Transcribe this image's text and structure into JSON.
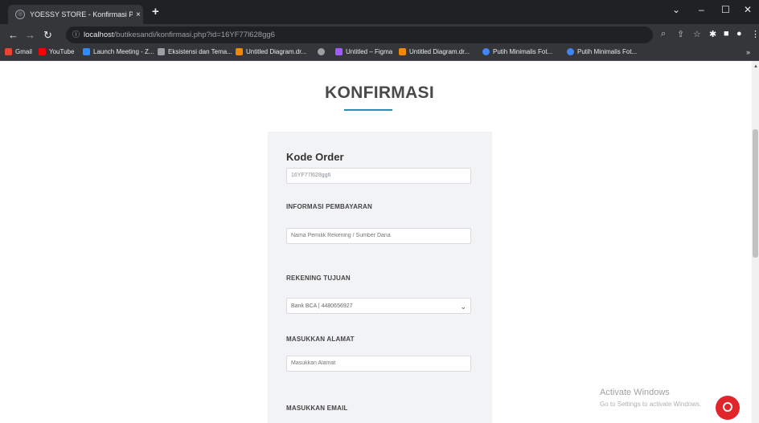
{
  "browser": {
    "tab_title": "YOESSY STORE - Konfirmasi Pem",
    "tab_close": "×",
    "new_tab": "+",
    "window_controls": [
      "⌄",
      "–",
      "☐",
      "✕"
    ],
    "url_host": "localhost",
    "url_path": "/butikesandi/konfirmasi.php?id=16YF77l628gg6",
    "bookmarks": [
      {
        "label": "Gmail",
        "color": "#ea4335"
      },
      {
        "label": "YouTube",
        "color": "#ff0000"
      },
      {
        "label": "Launch Meeting - Z...",
        "color": "#2d8cff"
      },
      {
        "label": "Eksistensi dan Tema...",
        "color": "#9aa0a6"
      },
      {
        "label": "Untitled Diagram.dr...",
        "color": "#f08705"
      },
      {
        "label": "",
        "color": "#9aa0a6"
      },
      {
        "label": "Untitled – Figma",
        "color": "#a259ff"
      },
      {
        "label": "Untitled Diagram.dr...",
        "color": "#f08705"
      },
      {
        "label": "Putih Minimalis Fot...",
        "color": "#4285f4"
      },
      {
        "label": "Putih Minimalis Fot...",
        "color": "#4285f4"
      }
    ]
  },
  "page": {
    "title": "KONFIRMASI",
    "accent_color": "#2a8fb0",
    "kode_order_label": "Kode Order",
    "kode_order_value": "16YF77l628gg6",
    "informasi_label": "INFORMASI PEMBAYARAN",
    "informasi_placeholder": "Nama Pemilik Rekening / Sumber Dana",
    "rekening_label": "REKENING TUJUAN",
    "rekening_selected": "Bank BCA | 4480656927",
    "alamat_label": "MASUKKAN ALAMAT",
    "alamat_placeholder": "Masukkan Alamat",
    "email_label": "MASUKKAN EMAIL"
  },
  "watermark": {
    "line1": "Activate Windows",
    "line2": "Go to Settings to activate Windows."
  }
}
